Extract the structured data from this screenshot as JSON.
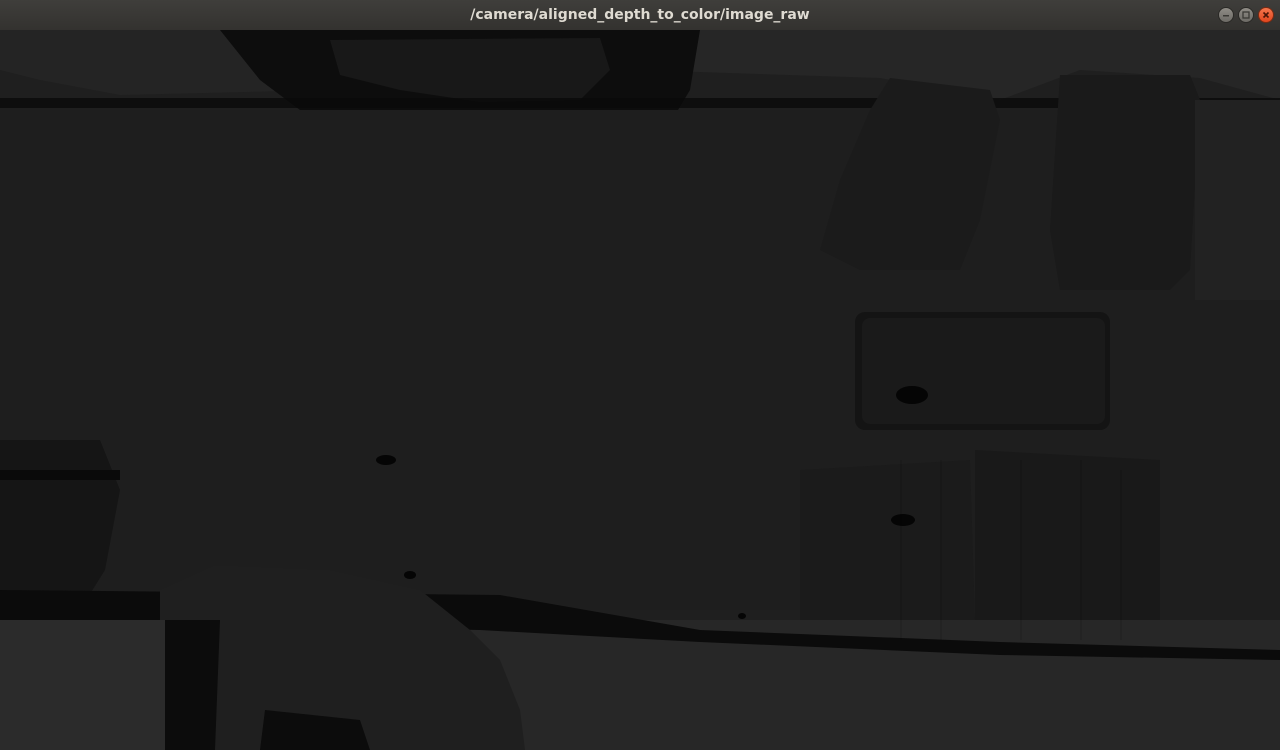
{
  "window": {
    "title": "/camera/aligned_depth_to_color/image_raw",
    "controls": {
      "minimize_icon": "minimize-icon",
      "maximize_icon": "maximize-icon",
      "close_icon": "close-icon"
    }
  },
  "image": {
    "content": "depth-image-grayscale",
    "colors": {
      "near": "#111111",
      "mid": "#1f1f1f",
      "far": "#2c2c2c",
      "invalid": "#000000"
    }
  }
}
